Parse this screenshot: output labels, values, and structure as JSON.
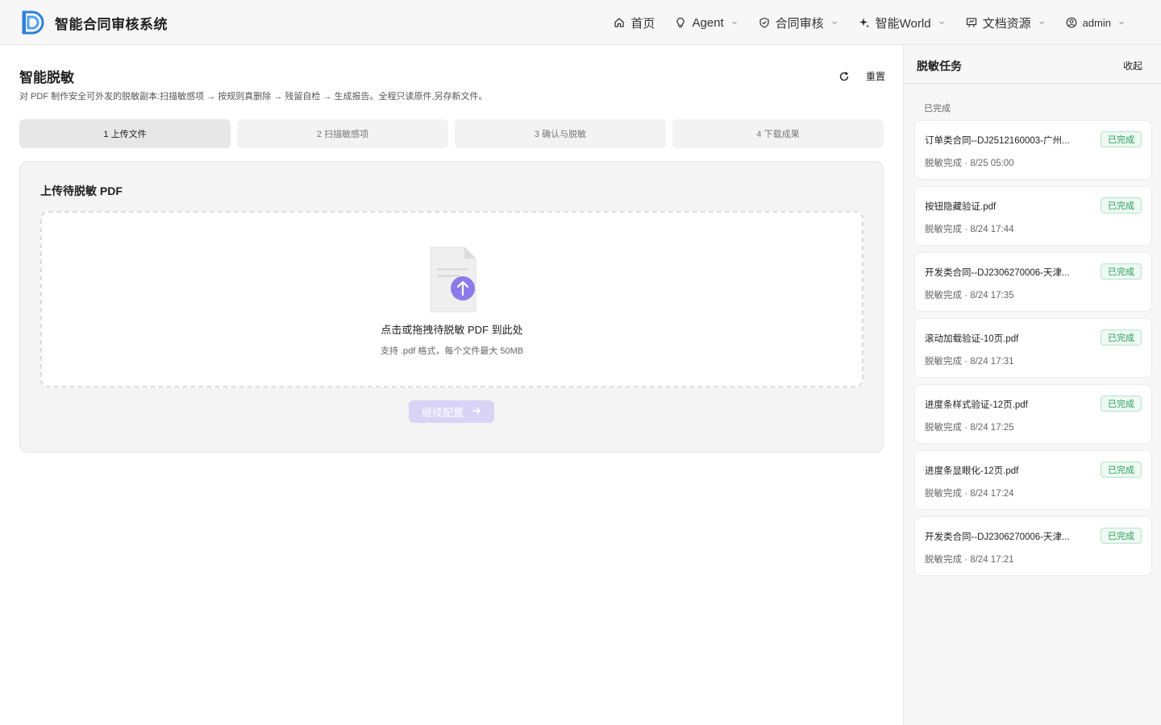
{
  "app": {
    "title": "智能合同审核系统",
    "nav": [
      {
        "label": "首页",
        "icon": "home-icon",
        "dropdown": false
      },
      {
        "label": "Agent",
        "icon": "bulb-icon",
        "dropdown": true
      },
      {
        "label": "合同审核",
        "icon": "shield-check-icon",
        "dropdown": true
      },
      {
        "label": "智能World",
        "icon": "sparkle-icon",
        "dropdown": true
      },
      {
        "label": "文档资源",
        "icon": "presentation-icon",
        "dropdown": true
      },
      {
        "label": "admin",
        "icon": "user-circle-icon",
        "dropdown": true
      }
    ]
  },
  "page": {
    "title": "智能脱敏",
    "description": "对 PDF 制作安全可外发的脱敏副本:扫描敏感项 → 按规则真删除 → 残留自检 → 生成报告。全程只读原件,另存新文件。",
    "reset_label": "重置",
    "steps": [
      {
        "label": "1 上传文件",
        "active": true
      },
      {
        "label": "2 扫描敏感项",
        "active": false
      },
      {
        "label": "3 确认与脱敏",
        "active": false
      },
      {
        "label": "4 下载成果",
        "active": false
      }
    ],
    "upload": {
      "title": "上传待脱敏 PDF",
      "drop_text": "点击或拖拽待脱敏 PDF 到此处",
      "hint": "支持 .pdf 格式，每个文件最大 50MB",
      "continue_label": "继续配置",
      "accent_color": "#8b7be8"
    }
  },
  "sidebar": {
    "title": "脱敏任务",
    "collapse_label": "收起",
    "section_label": "已完成",
    "tasks": [
      {
        "name": "订单类合同--DJ2512160003-广州...",
        "status": "已完成",
        "sub": "脱敏完成 · 8/25 05:00"
      },
      {
        "name": "按钮隐藏验证.pdf",
        "status": "已完成",
        "sub": "脱敏完成 · 8/24 17:44"
      },
      {
        "name": "开发类合同--DJ2306270006-天津...",
        "status": "已完成",
        "sub": "脱敏完成 · 8/24 17:35"
      },
      {
        "name": "滚动加载验证-10页.pdf",
        "status": "已完成",
        "sub": "脱敏完成 · 8/24 17:31"
      },
      {
        "name": "进度条样式验证-12页.pdf",
        "status": "已完成",
        "sub": "脱敏完成 · 8/24 17:25"
      },
      {
        "name": "进度条显眼化-12页.pdf",
        "status": "已完成",
        "sub": "脱敏完成 · 8/24 17:24"
      },
      {
        "name": "开发类合同--DJ2306270006-天津...",
        "status": "已完成",
        "sub": "脱敏完成 · 8/24 17:21"
      }
    ]
  }
}
